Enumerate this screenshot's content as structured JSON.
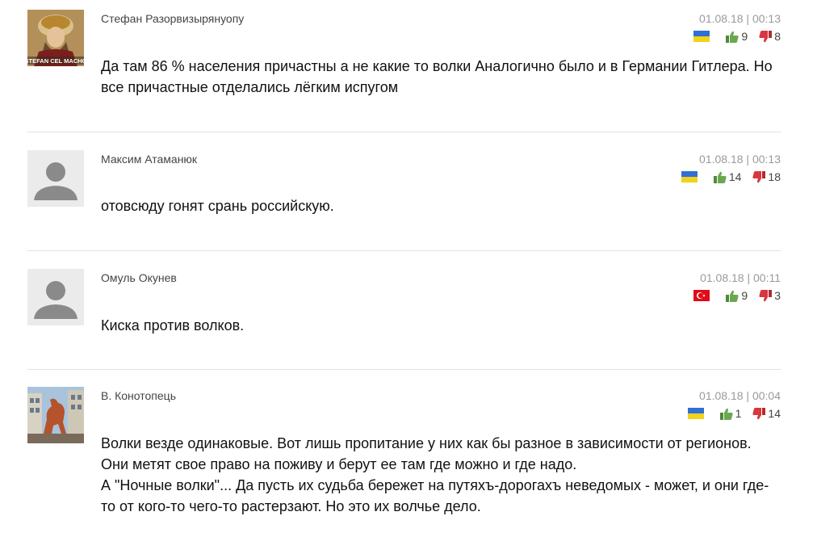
{
  "comments": [
    {
      "author": "Стефан Разорвизырянуопу",
      "date": "01.08.18 | 00:13",
      "flag": "ukraine-flag",
      "likes": "9",
      "dislikes": "8",
      "text": "Да там 86 % населения причастны а не какие то волки Аналогично было и в Германии Гитлера. Но все причастные отделались лёгким испугом",
      "avatar_caption": "STEFAN CEL MACHO"
    },
    {
      "author": "Максим Атаманюк",
      "date": "01.08.18 | 00:13",
      "flag": "ukraine-flag",
      "likes": "14",
      "dislikes": "18",
      "text": "отовсюду гонят срань российскую."
    },
    {
      "author": "Омуль Окунев",
      "date": "01.08.18 | 00:11",
      "flag": "turkey-flag",
      "likes": "9",
      "dislikes": "3",
      "text": "Киска против волков."
    },
    {
      "author": "В. Конотопець",
      "date": "01.08.18 | 00:04",
      "flag": "ukraine-flag",
      "likes": "1",
      "dislikes": "14",
      "text_lines": [
        "Волки везде одинаковые. Вот лишь пропитание у них как бы разное в зависимости от регионов. Они метят свое право на поживу и берут ее там где можно и где надо.",
        "А \"Ночные волки\"... Да пусть их судьба бережет на путяхъ-дорогахъ неведомых - может, и они где-то от кого-то чего-то растерзают. Но это их волчье дело."
      ]
    }
  ],
  "colors": {
    "like": "#6aa84f",
    "dislike": "#d9363e",
    "ukraine_blue": "#2f6fd6",
    "ukraine_yellow": "#f2d21b",
    "turkey_red": "#e30a17"
  }
}
